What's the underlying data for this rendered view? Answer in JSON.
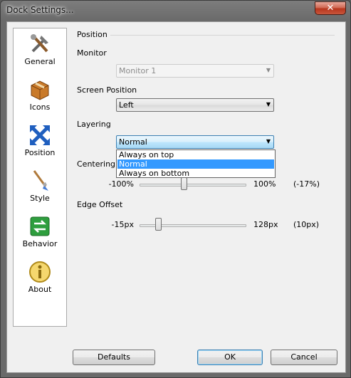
{
  "window": {
    "title": "Dock Settings...",
    "close_glyph": "✕"
  },
  "sidebar": {
    "items": [
      {
        "label": "General",
        "icon": "tools-icon"
      },
      {
        "label": "Icons",
        "icon": "package-icon"
      },
      {
        "label": "Position",
        "icon": "move-arrows-icon"
      },
      {
        "label": "Style",
        "icon": "paintbrush-icon"
      },
      {
        "label": "Behavior",
        "icon": "swap-arrows-icon"
      },
      {
        "label": "About",
        "icon": "info-icon"
      }
    ]
  },
  "position": {
    "group_title": "Position",
    "monitor": {
      "label": "Monitor",
      "value": "Monitor 1"
    },
    "screen_position": {
      "label": "Screen Position",
      "value": "Left"
    },
    "layering": {
      "label": "Layering",
      "value": "Normal",
      "options": [
        "Always on top",
        "Normal",
        "Always on bottom"
      ],
      "selected_index": 1
    },
    "centering": {
      "label": "Centering",
      "min": "-100%",
      "max": "100%",
      "current": "(-17%)",
      "level": 0.415
    },
    "edge_offset": {
      "label": "Edge Offset",
      "min": "-15px",
      "max": "128px",
      "current": "(10px)",
      "level": 0.175
    }
  },
  "buttons": {
    "defaults": "Defaults",
    "ok": "OK",
    "cancel": "Cancel"
  },
  "colors": {
    "selection": "#3399ff",
    "close": "#c9563c"
  }
}
